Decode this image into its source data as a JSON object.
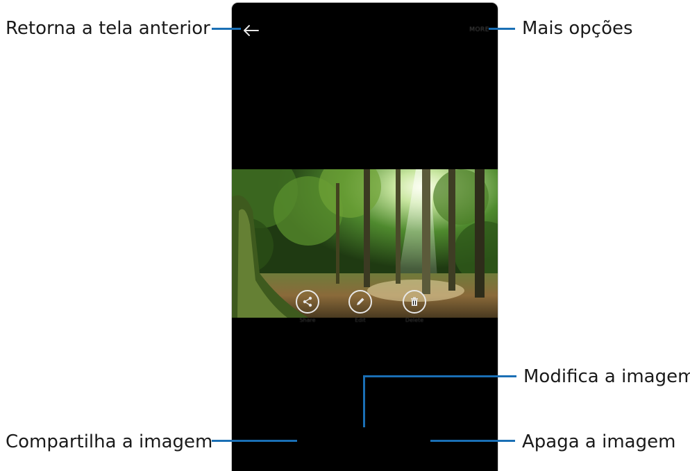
{
  "callouts": {
    "back": "Retorna a tela anterior",
    "more": "Mais opções",
    "edit": "Modifica a imagem",
    "share": "Compartilha a imagem",
    "delete": "Apaga a imagem"
  },
  "toolbar": {
    "more_label": "MORE"
  },
  "actions": {
    "share_label": "Share",
    "edit_label": "Edit",
    "delete_label": "Delete"
  },
  "icons": {
    "back": "arrow-left-icon",
    "share": "share-icon",
    "edit": "pencil-icon",
    "delete": "trash-icon"
  },
  "colors": {
    "screen_background": "#000000",
    "callout_line": "#1a6fb5",
    "icon_stroke": "#e8e8e8"
  }
}
